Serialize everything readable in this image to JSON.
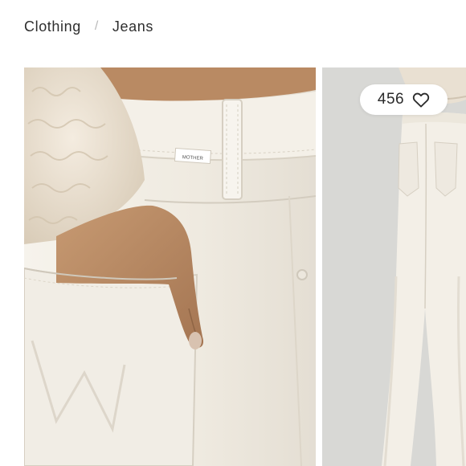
{
  "breadcrumb": {
    "items": [
      "Clothing",
      "Jeans"
    ],
    "separator": "/"
  },
  "gallery": {
    "images": [
      {
        "label": "MOTHER",
        "icon": "product-photo-back-pocket"
      },
      {
        "icon": "product-photo-full-back"
      }
    ]
  },
  "likes": {
    "count": "456",
    "icon": "heart-outline-icon"
  },
  "colors": {
    "denim": "#f3efe6",
    "sweater": "#ece2d2",
    "skin": "#b48660",
    "studio_bg": "#d7d7d4"
  }
}
